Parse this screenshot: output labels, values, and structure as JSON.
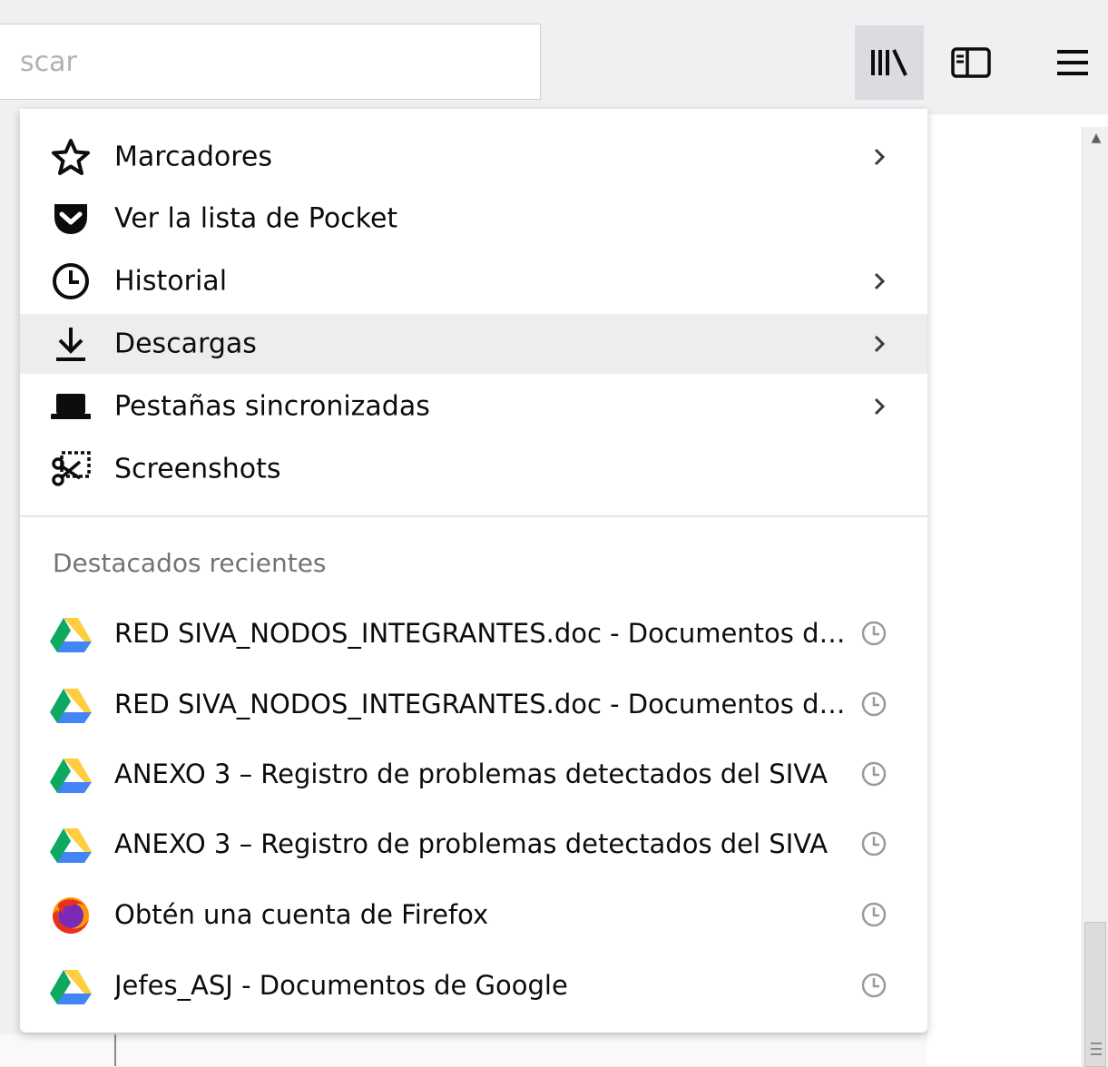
{
  "toolbar": {
    "search_value": "scar",
    "search_placeholder": "Buscar"
  },
  "library_menu": {
    "items": [
      {
        "label": "Marcadores",
        "icon": "star-icon",
        "has_submenu": true
      },
      {
        "label": "Ver la lista de Pocket",
        "icon": "pocket-icon",
        "has_submenu": false
      },
      {
        "label": "Historial",
        "icon": "clock-icon",
        "has_submenu": true
      },
      {
        "label": "Descargas",
        "icon": "download-icon",
        "has_submenu": true,
        "hovered": true
      },
      {
        "label": "Pestañas sincronizadas",
        "icon": "synced-tabs-icon",
        "has_submenu": true
      },
      {
        "label": "Screenshots",
        "icon": "screenshot-icon",
        "has_submenu": false
      }
    ],
    "recent_header": "Destacados recientes",
    "recent": [
      {
        "label": "RED SIVA_NODOS_INTEGRANTES.doc - Documentos de Google",
        "icon": "google-drive-icon"
      },
      {
        "label": "RED SIVA_NODOS_INTEGRANTES.doc - Documentos de Google",
        "icon": "google-drive-icon"
      },
      {
        "label": "ANEXO 3 – Registro de problemas detectados del SIVA",
        "icon": "google-drive-icon"
      },
      {
        "label": "ANEXO 3 – Registro de problemas detectados del SIVA",
        "icon": "google-drive-icon"
      },
      {
        "label": "Obtén una cuenta de Firefox",
        "icon": "firefox-icon"
      },
      {
        "label": "Jefes_ASJ - Documentos de Google",
        "icon": "google-drive-icon"
      }
    ]
  },
  "colors": {
    "hover_row": "#ededf0",
    "drive_green": "#0da960",
    "drive_yellow": "#ffcd40",
    "drive_blue": "#4285f4"
  }
}
